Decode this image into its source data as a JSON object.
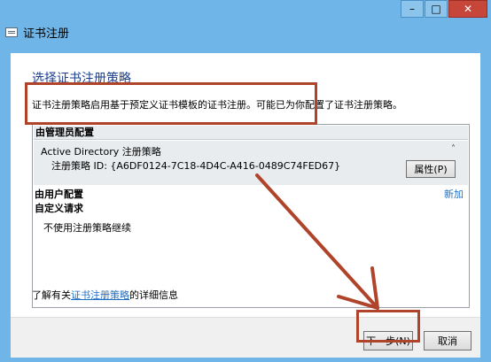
{
  "window": {
    "title": "证书注册",
    "controls": {
      "minimize": "–",
      "maximize": "□",
      "close": "✕"
    }
  },
  "page": {
    "heading": "选择证书注册策略",
    "description": "证书注册策略启用基于预定义证书模板的证书注册。可能已为你配置了证书注册策略。"
  },
  "admin_group": {
    "header": "由管理员配置",
    "policy_name": "Active Directory 注册策略",
    "policy_id": "注册策略 ID: {A6DF0124-7C18-4D4C-A416-0489C74FED67}",
    "collapse_glyph": "˄",
    "properties_button": "属性(P)"
  },
  "user_group": {
    "header": "由用户配置",
    "add_link": "新加",
    "custom_header": "自定义请求",
    "custom_note": "不使用注册策略继续"
  },
  "learn_more": {
    "prefix": "了解有关",
    "link": "证书注册策略",
    "suffix": "的详细信息"
  },
  "footer": {
    "next_button": "下一步(N)",
    "cancel_button": "取消"
  },
  "colors": {
    "chrome": "#6fb5e8",
    "heading": "#1a3e8c",
    "link": "#1e6fc6",
    "annotation": "#b0442b"
  }
}
